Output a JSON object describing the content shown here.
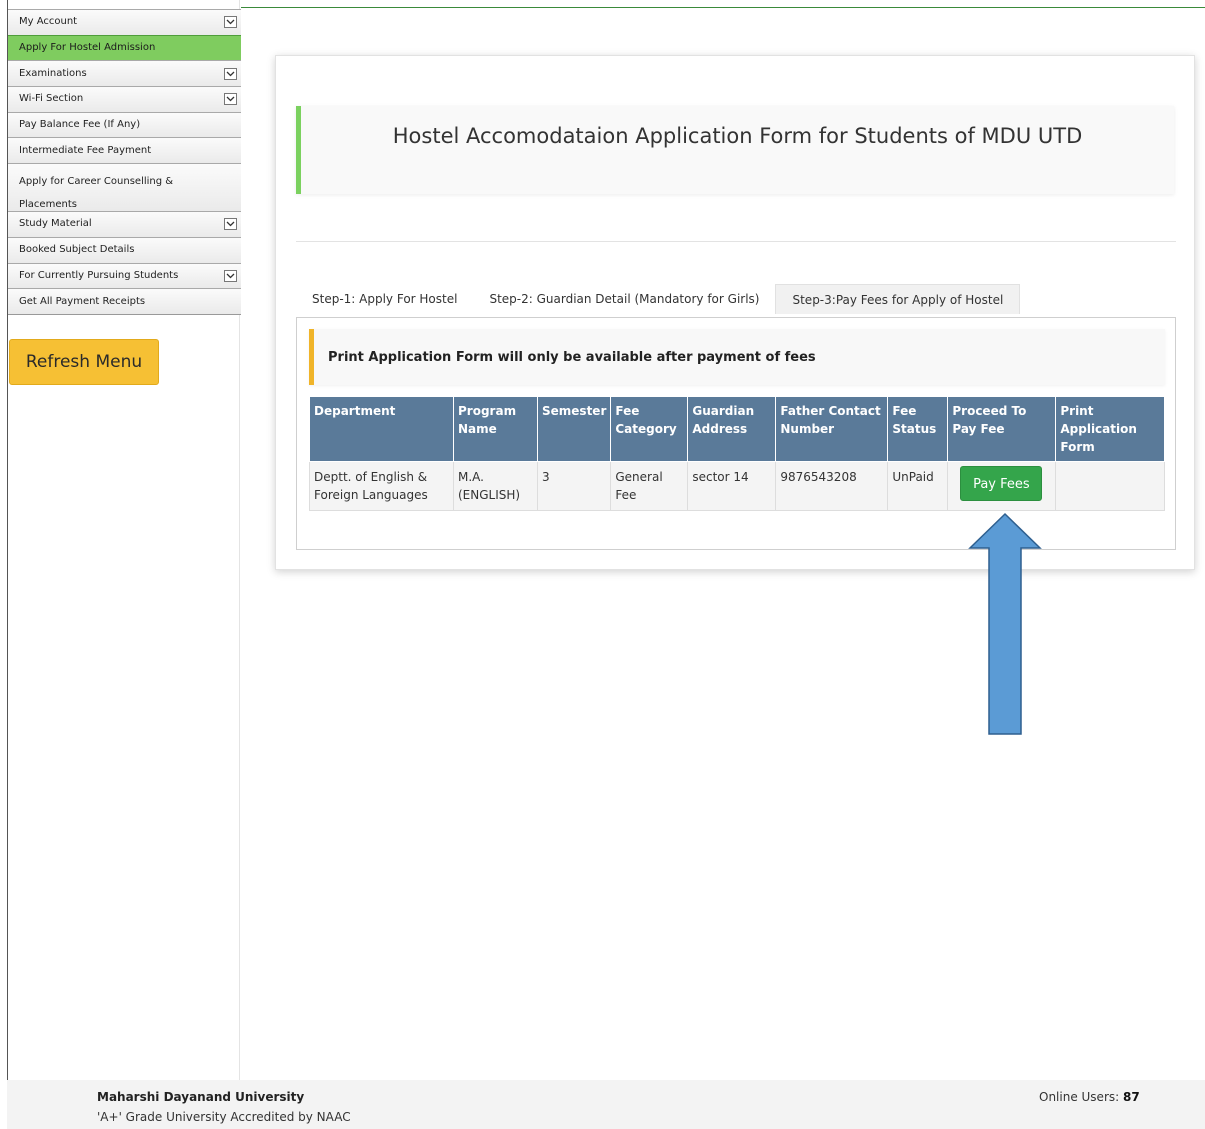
{
  "sidebar": {
    "items": [
      {
        "label": "My Account",
        "dropdown": true,
        "active": false
      },
      {
        "label": "Apply For Hostel Admission",
        "dropdown": false,
        "active": true
      },
      {
        "label": "Examinations",
        "dropdown": true,
        "active": false
      },
      {
        "label": "Wi-Fi Section",
        "dropdown": true,
        "active": false
      },
      {
        "label": "Pay Balance Fee (If Any)",
        "dropdown": false,
        "active": false
      },
      {
        "label": "Intermediate Fee Payment",
        "dropdown": false,
        "active": false
      },
      {
        "label": "Apply for Career Counselling & Placements",
        "dropdown": false,
        "active": false
      },
      {
        "label": "Study Material",
        "dropdown": true,
        "active": false
      },
      {
        "label": "Booked Subject Details",
        "dropdown": false,
        "active": false
      },
      {
        "label": "For Currently Pursuing Students",
        "dropdown": true,
        "active": false
      },
      {
        "label": "Get All Payment Receipts",
        "dropdown": false,
        "active": false
      }
    ],
    "refresh_label": "Refresh Menu"
  },
  "main": {
    "title": "Hostel Accomodataion Application Form for Students of MDU UTD",
    "tabs": [
      {
        "label": "Step-1: Apply For Hostel"
      },
      {
        "label": "Step-2: Guardian Detail (Mandatory for Girls)"
      },
      {
        "label": "Step-3:Pay Fees for Apply of Hostel"
      }
    ],
    "notice": "Print Application Form will only be available after payment of fees",
    "table": {
      "headers": [
        "Department",
        "Program Name",
        "Semester",
        "Fee Category",
        "Guardian Address",
        "Father Contact Number",
        "Fee Status",
        "Proceed To Pay Fee",
        "Print Application Form"
      ],
      "rows": [
        {
          "department": "Deptt. of English & Foreign Languages",
          "program": "M.A. (ENGLISH)",
          "semester": "3",
          "fee_category": "General Fee",
          "guardian_address": "sector 14",
          "father_contact": "9876543208",
          "fee_status": "UnPaid",
          "pay_button": "Pay Fees",
          "print_form": ""
        }
      ]
    }
  },
  "footer": {
    "university": "Maharshi Dayanand University",
    "accreditation": "'A+' Grade University Accredited by NAAC",
    "online_label": "Online Users:",
    "online_count": "87"
  },
  "colors": {
    "active_menu": "#7fcc5f",
    "table_header": "#5a7a99",
    "pay_button": "#34a54b",
    "refresh_button": "#f6c034",
    "notice_accent": "#f0b429",
    "title_accent": "#7bd15f",
    "arrow_fill": "#5b9bd5"
  }
}
